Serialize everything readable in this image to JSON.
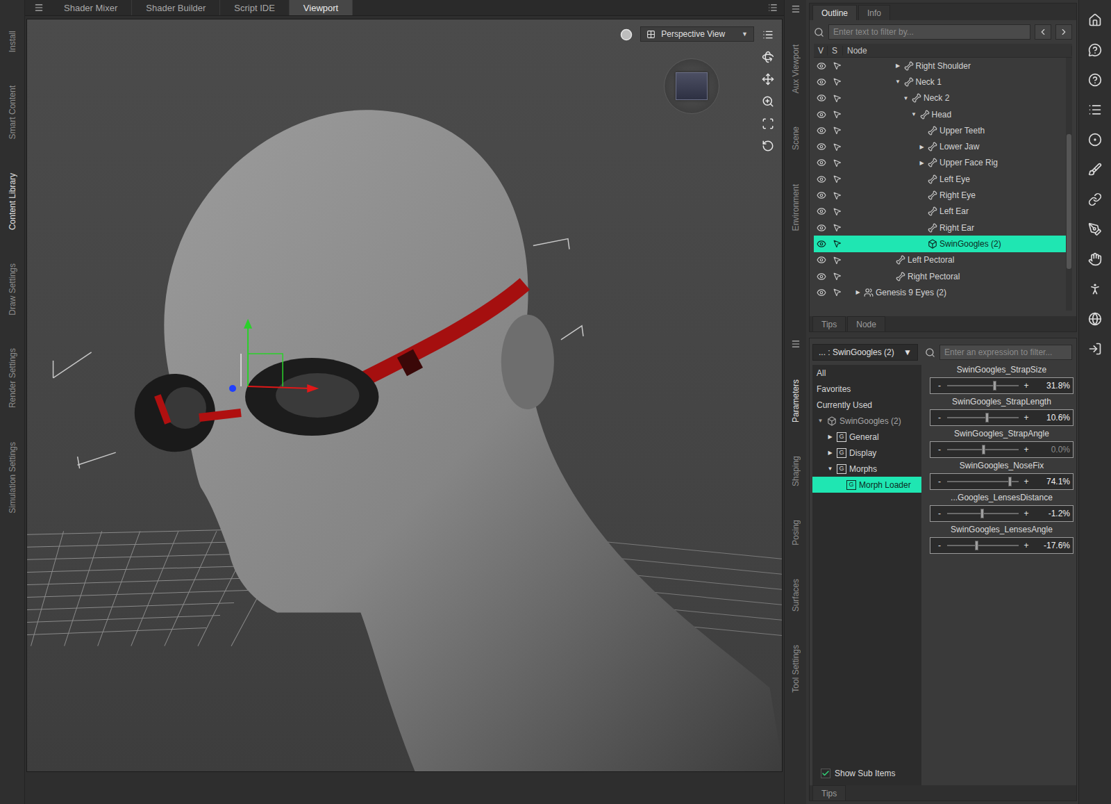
{
  "left_tabs": [
    {
      "label": "Install",
      "selected": false
    },
    {
      "label": "Smart Content",
      "selected": false
    },
    {
      "label": "Content Library",
      "selected": true
    },
    {
      "label": "Draw Settings",
      "selected": false
    },
    {
      "label": "Render Settings",
      "selected": false
    },
    {
      "label": "Simulation Settings",
      "selected": false
    }
  ],
  "top_tabs": [
    {
      "label": "Shader Mixer",
      "selected": false
    },
    {
      "label": "Shader Builder",
      "selected": false
    },
    {
      "label": "Script IDE",
      "selected": false
    },
    {
      "label": "Viewport",
      "selected": true
    }
  ],
  "viewport": {
    "view": "Perspective View",
    "dropdown": "▼"
  },
  "side_tabs_top": [
    {
      "label": "Aux Viewport",
      "selected": false
    },
    {
      "label": "Scene",
      "selected": false
    },
    {
      "label": "Environment",
      "selected": false
    }
  ],
  "side_tabs_bottom": [
    {
      "label": "Parameters",
      "selected": true
    },
    {
      "label": "Shaping",
      "selected": false
    },
    {
      "label": "Posing",
      "selected": false
    },
    {
      "label": "Surfaces",
      "selected": false
    },
    {
      "label": "Tool Settings",
      "selected": false
    }
  ],
  "outline": {
    "tabs": [
      {
        "label": "Outline",
        "selected": true
      },
      {
        "label": "Info",
        "selected": false
      }
    ],
    "search_placeholder": "Enter text to filter by...",
    "columns": [
      "V",
      "S",
      "Node"
    ],
    "rows": [
      {
        "name": "Right Shoulder",
        "depth": 5,
        "expander": "▶",
        "kind": "bone",
        "visible": true,
        "selectable": true,
        "selected": false
      },
      {
        "name": "Neck 1",
        "depth": 5,
        "expander": "▼",
        "kind": "bone",
        "visible": true,
        "selectable": true,
        "selected": false
      },
      {
        "name": "Neck 2",
        "depth": 6,
        "expander": "▼",
        "kind": "bone",
        "visible": true,
        "selectable": true,
        "selected": false
      },
      {
        "name": "Head",
        "depth": 7,
        "expander": "▼",
        "kind": "bone",
        "visible": true,
        "selectable": true,
        "selected": false
      },
      {
        "name": "Upper Teeth",
        "depth": 8,
        "expander": "",
        "kind": "bone",
        "visible": true,
        "selectable": true,
        "selected": false
      },
      {
        "name": "Lower Jaw",
        "depth": 8,
        "expander": "▶",
        "kind": "bone",
        "visible": true,
        "selectable": true,
        "selected": false
      },
      {
        "name": "Upper Face Rig",
        "depth": 8,
        "expander": "▶",
        "kind": "bone",
        "visible": true,
        "selectable": true,
        "selected": false
      },
      {
        "name": "Left Eye",
        "depth": 8,
        "expander": "",
        "kind": "bone",
        "visible": true,
        "selectable": true,
        "selected": false
      },
      {
        "name": "Right Eye",
        "depth": 8,
        "expander": "",
        "kind": "bone",
        "visible": true,
        "selectable": true,
        "selected": false
      },
      {
        "name": "Left Ear",
        "depth": 8,
        "expander": "",
        "kind": "bone",
        "visible": true,
        "selectable": true,
        "selected": false
      },
      {
        "name": "Right Ear",
        "depth": 8,
        "expander": "",
        "kind": "bone",
        "visible": true,
        "selectable": true,
        "selected": false
      },
      {
        "name": "SwinGoogles (2)",
        "depth": 8,
        "expander": "",
        "kind": "prop",
        "visible": true,
        "selectable": true,
        "selected": true
      },
      {
        "name": "Left Pectoral",
        "depth": 4,
        "expander": "",
        "kind": "bone",
        "visible": true,
        "selectable": true,
        "selected": false
      },
      {
        "name": "Right Pectoral",
        "depth": 4,
        "expander": "",
        "kind": "bone",
        "visible": true,
        "selectable": true,
        "selected": false
      },
      {
        "name": "Genesis 9 Eyes (2)",
        "depth": 0,
        "expander": "▶",
        "kind": "figure",
        "visible": true,
        "selectable": true,
        "selected": false
      }
    ],
    "bottom_tabs": [
      {
        "label": "Tips",
        "selected": false
      },
      {
        "label": "Node",
        "selected": false
      }
    ]
  },
  "parameters": {
    "node_selector": "... : SwinGoogles (2)",
    "selector_arrow": "▼",
    "filter_placeholder": "Enter an expression to filter...",
    "groups": [
      {
        "label": "All",
        "depth": 0,
        "expander": "",
        "badge": "",
        "kind": "filter",
        "selected": false
      },
      {
        "label": "Favorites",
        "depth": 0,
        "expander": "",
        "badge": "",
        "kind": "filter",
        "selected": false
      },
      {
        "label": "Currently Used",
        "depth": 0,
        "expander": "",
        "badge": "",
        "kind": "filter",
        "selected": false
      },
      {
        "label": "SwinGoogles (2)",
        "depth": 0,
        "expander": "▼",
        "badge": "",
        "kind": "node",
        "selected": false
      },
      {
        "label": "General",
        "depth": 1,
        "expander": "▶",
        "badge": "G",
        "kind": "group",
        "selected": false
      },
      {
        "label": "Display",
        "depth": 1,
        "expander": "▶",
        "badge": "G",
        "kind": "group",
        "selected": false
      },
      {
        "label": "Morphs",
        "depth": 1,
        "expander": "▼",
        "badge": "G",
        "kind": "group",
        "selected": false
      },
      {
        "label": "Morph Loader",
        "depth": 2,
        "expander": "",
        "badge": "G",
        "kind": "group",
        "selected": true
      }
    ],
    "slider_minus": "-",
    "slider_plus": "+",
    "sliders": [
      {
        "label": "SwinGoogles_StrapSize",
        "value": "31.8%",
        "level": 0.66,
        "dim": false
      },
      {
        "label": "SwinGoogles_StrapLength",
        "value": "10.6%",
        "level": 0.55,
        "dim": false
      },
      {
        "label": "SwinGoogles_StrapAngle",
        "value": "0.0%",
        "level": 0.5,
        "dim": true
      },
      {
        "label": "SwinGoogles_NoseFix",
        "value": "74.1%",
        "level": 0.87,
        "dim": false
      },
      {
        "label": "...Googles_LensesDistance",
        "value": "-1.2%",
        "level": 0.49,
        "dim": false
      },
      {
        "label": "SwinGoogles_LensesAngle",
        "value": "-17.6%",
        "level": 0.41,
        "dim": false
      }
    ],
    "show_sub_items": {
      "label": "Show Sub Items",
      "checked": true
    },
    "bottom_tabs": [
      {
        "label": "Tips",
        "selected": false
      }
    ]
  }
}
